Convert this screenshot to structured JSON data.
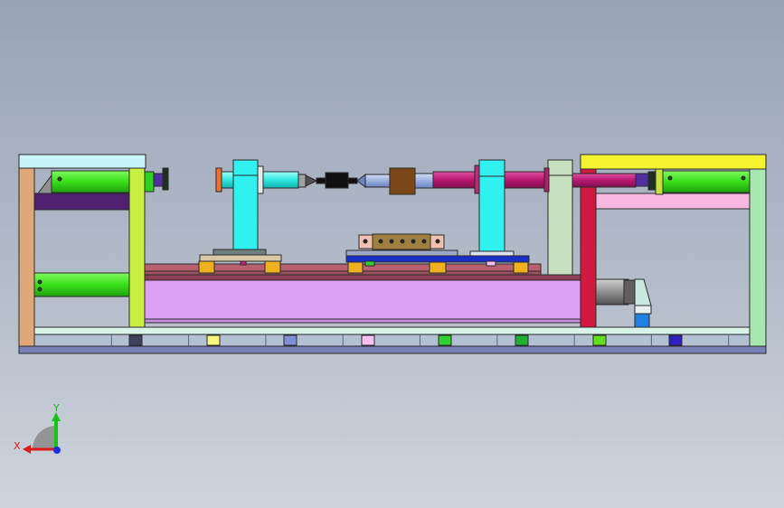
{
  "triad": {
    "x_label": "X",
    "y_label": "Y",
    "x_color": "#e01818",
    "y_color": "#18c018",
    "z_color": "#1830e0"
  },
  "palette": {
    "background_top": "#98a3b6",
    "background_bottom": "#cfd4dc",
    "outline": "#2a2a2a",
    "frame_post_left": "#e0a878",
    "frame_post_green": "#c8f040",
    "frame_post_mint": "#a8e8b0",
    "crimson_post": "#d01840",
    "top_plate_left": "#c8f4f8",
    "top_plate_right": "#f4f430",
    "cylinder_green": "#40e020",
    "cylinder_magenta": "#b81870",
    "purple_bar": "#502070",
    "pink_bar": "#f8b8e0",
    "bed_lilac": "#dca0f4",
    "rail_brown": "#a05060",
    "carriage_blue": "#1830c8",
    "block_orange": "#f0b020",
    "support_cyan": "#30f0f0",
    "shaft_light": "#9bb0e0",
    "coupler_black": "#101010",
    "tool_brown": "#7a4818",
    "clamp_olive": "#a08040",
    "clamp_salmon": "#f0c0b0",
    "tall_plate_green": "#c8e0c0",
    "motor_grey": "#808080",
    "base_grey": "#b4c0d4",
    "base_strip": "#d8f4e8",
    "base_bottom": "#7880b8",
    "marker_colors": [
      "#404060",
      "#f8f880",
      "#8090d8",
      "#f8c0f0",
      "#30d030",
      "#20b030",
      "#60e020",
      "#3020c0"
    ]
  }
}
